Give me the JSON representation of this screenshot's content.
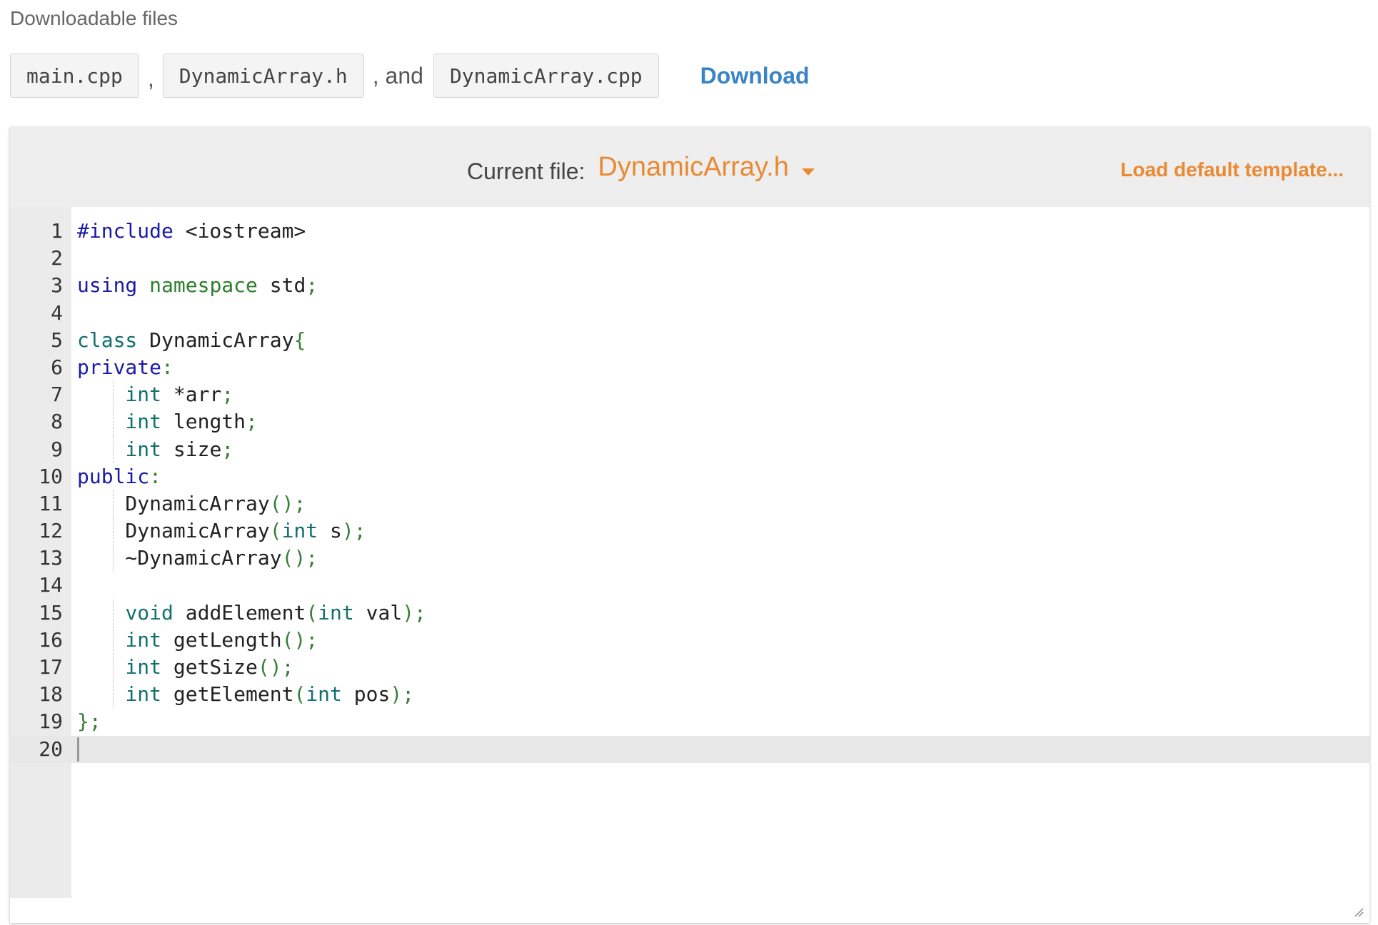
{
  "header": {
    "title": "Downloadable files",
    "files": [
      "main.cpp",
      "DynamicArray.h",
      "DynamicArray.cpp"
    ],
    "separator": ",",
    "and_text": ", and",
    "download_label": "Download"
  },
  "editor": {
    "current_file_label": "Current file:",
    "current_file": "DynamicArray.h",
    "load_template_label": "Load default template...",
    "active_line": 20,
    "lines": [
      "#include <iostream>",
      "",
      "using namespace std;",
      "",
      "class DynamicArray{",
      "private:",
      "    int *arr;",
      "    int length;",
      "    int size;",
      "public:",
      "    DynamicArray();",
      "    DynamicArray(int s);",
      "    ~DynamicArray();",
      "",
      "    void addElement(int val);",
      "    int getLength();",
      "    int getSize();",
      "    int getElement(int pos);",
      "};",
      ""
    ]
  },
  "colors": {
    "accent_orange": "#e98a32",
    "link_blue": "#3a84c5",
    "keyword_blue": "#1a1aa6",
    "keyword_green": "#2a7f2a",
    "type_teal": "#11706e"
  },
  "icons": {
    "dropdown": "caret-down-icon",
    "resize": "resize-grip-icon"
  }
}
